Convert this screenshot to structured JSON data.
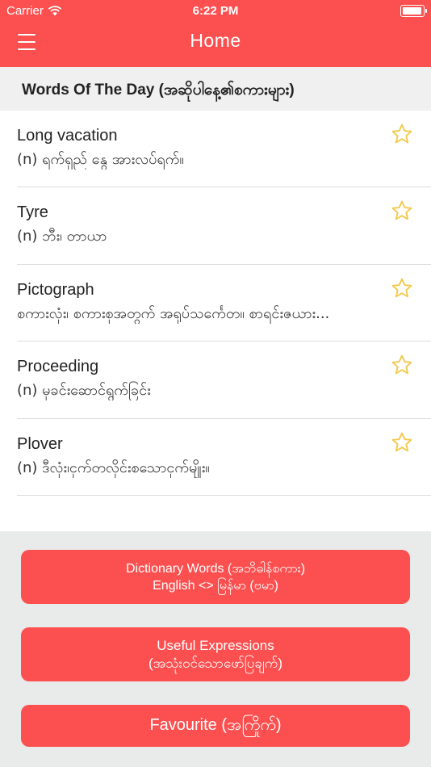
{
  "status_bar": {
    "carrier": "Carrier",
    "time": "6:22 PM",
    "battery_level": 0.95
  },
  "navbar": {
    "title": "Home",
    "menu_icon": "hamburger-icon"
  },
  "section": {
    "title": "Words Of The Day (အဆိုပါနေ့၏စကားများ)"
  },
  "words": [
    {
      "word": "Long vacation",
      "definition": "(n) ရက်ရှည် နွေ အားလပ်ရက်။"
    },
    {
      "word": "Tyre",
      "definition": "(n) ဘီး၊ တာယာ"
    },
    {
      "word": "Pictograph",
      "definition": "စကားလုံး၊ စကားစုအတွက် အရုပ်သင်္ကေတ။ စာရင်းဇယား..."
    },
    {
      "word": "Proceeding",
      "definition": "(n) မှခင်းဆောင်ရွက်ခြင်း"
    },
    {
      "word": "Plover",
      "definition": "(n) ဒီလုံး၊ငှက်တလိုင်းစသောငှက်မျိုး။"
    }
  ],
  "buttons": {
    "dictionary_line1": "Dictionary Words (အဘိဓါန်စကား)",
    "dictionary_line2": "English <> မြန်မာ (ဗမာ)",
    "useful_line1": "Useful Expressions",
    "useful_line2": "(အသုံးဝင်သောဖော်ပြချက်)",
    "favourite": "Favourite (အကြိုက်)"
  },
  "colors": {
    "accent": "#fc5050",
    "panel": "#e9ebeb",
    "header_bg": "#f0f0f0",
    "star": "#f2c94c"
  }
}
